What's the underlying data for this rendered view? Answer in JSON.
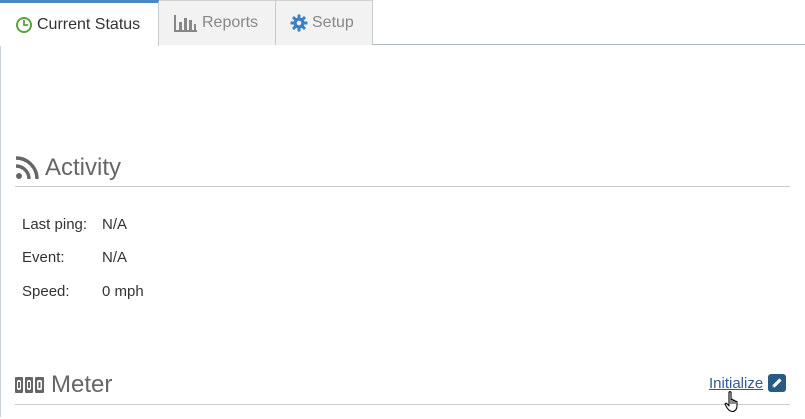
{
  "tabs": [
    {
      "label": "Current Status",
      "icon": "clock-icon",
      "icon_color": "#5aa142",
      "active": true
    },
    {
      "label": "Reports",
      "icon": "bar-chart-icon",
      "active": false
    },
    {
      "label": "Setup",
      "icon": "gear-icon",
      "icon_color": "#3b82c4",
      "active": false
    }
  ],
  "activity": {
    "title": "Activity",
    "icon": "rss-icon",
    "rows": [
      {
        "label": "Last ping:",
        "value": "N/A"
      },
      {
        "label": "Event:",
        "value": "N/A"
      },
      {
        "label": "Speed:",
        "value": "0 mph"
      }
    ]
  },
  "meter": {
    "title": "Meter",
    "icon": "odometer-icon",
    "initialize_label": "Initialize",
    "initialize_icon": "pencil-icon"
  },
  "colors": {
    "accent": "#4a87c4",
    "link": "#2f5e8e",
    "edit_badge": "#275b86"
  }
}
